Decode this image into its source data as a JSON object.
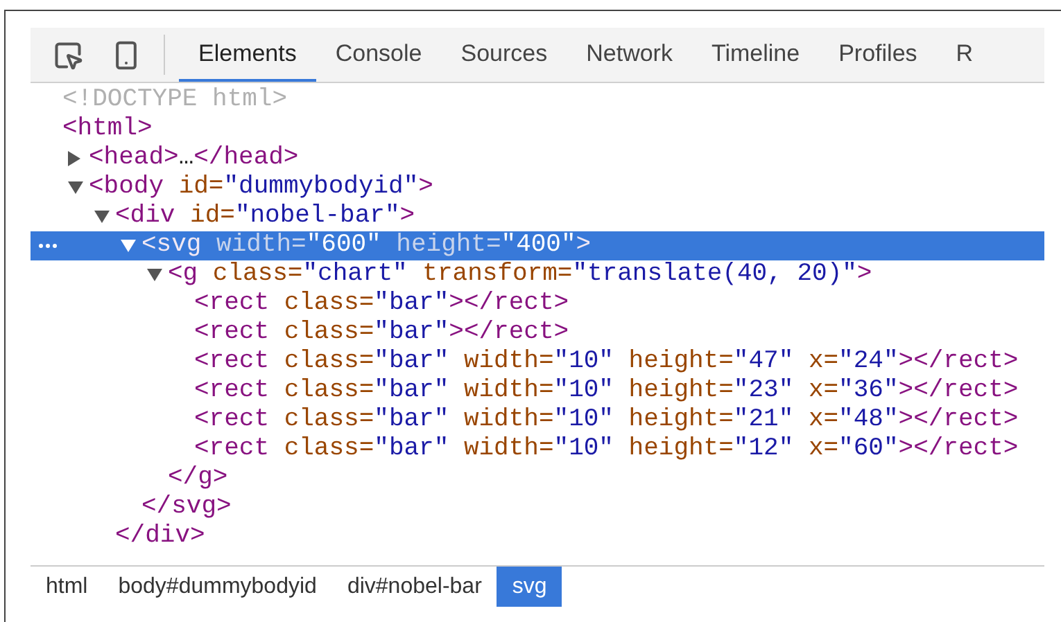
{
  "tabs": [
    {
      "label": "Elements",
      "selected": true
    },
    {
      "label": "Console",
      "selected": false
    },
    {
      "label": "Sources",
      "selected": false
    },
    {
      "label": "Network",
      "selected": false
    },
    {
      "label": "Timeline",
      "selected": false
    },
    {
      "label": "Profiles",
      "selected": false
    },
    {
      "label": "R",
      "selected": false
    }
  ],
  "tree": [
    {
      "selected": false,
      "tokens": [
        {
          "kind": "doctype",
          "text": "<!DOCTYPE html>"
        }
      ]
    },
    {
      "selected": false,
      "tokens": [
        {
          "kind": "tag",
          "text": "<html>"
        }
      ],
      "children": [
        {
          "selected": false,
          "expanded": false,
          "tokens": [
            {
              "kind": "tag",
              "text": "<head>"
            },
            {
              "kind": "text",
              "text": "…"
            },
            {
              "kind": "tag",
              "text": "</head>"
            }
          ]
        },
        {
          "selected": false,
          "expanded": true,
          "tokens": [
            {
              "kind": "tag",
              "text": "<body"
            },
            {
              "kind": "attr",
              "text": " id="
            },
            {
              "kind": "value",
              "text": "\"dummybodyid\""
            },
            {
              "kind": "tag",
              "text": ">"
            }
          ],
          "children": [
            {
              "selected": false,
              "expanded": true,
              "tokens": [
                {
                  "kind": "tag",
                  "text": "<div"
                },
                {
                  "kind": "attr",
                  "text": " id="
                },
                {
                  "kind": "value",
                  "text": "\"nobel-bar\""
                },
                {
                  "kind": "tag",
                  "text": ">"
                }
              ],
              "close": [
                {
                  "kind": "tag",
                  "text": "</div>"
                }
              ],
              "children": [
                {
                  "selected": true,
                  "expanded": true,
                  "tokens": [
                    {
                      "kind": "tag",
                      "text": "<svg"
                    },
                    {
                      "kind": "attr",
                      "text": " width="
                    },
                    {
                      "kind": "value",
                      "text": "\"600\""
                    },
                    {
                      "kind": "attr",
                      "text": " height="
                    },
                    {
                      "kind": "value",
                      "text": "\"400\""
                    },
                    {
                      "kind": "tag",
                      "text": ">"
                    }
                  ],
                  "close": [
                    {
                      "kind": "tag",
                      "text": "</svg>"
                    }
                  ],
                  "children": [
                    {
                      "selected": false,
                      "expanded": true,
                      "tokens": [
                        {
                          "kind": "tag",
                          "text": "<g"
                        },
                        {
                          "kind": "attr",
                          "text": " class="
                        },
                        {
                          "kind": "value",
                          "text": "\"chart\""
                        },
                        {
                          "kind": "attr",
                          "text": " transform="
                        },
                        {
                          "kind": "value",
                          "text": "\"translate(40, 20)\""
                        },
                        {
                          "kind": "tag",
                          "text": ">"
                        }
                      ],
                      "close": [
                        {
                          "kind": "tag",
                          "text": "</g>"
                        }
                      ],
                      "children": [
                        {
                          "selected": false,
                          "tokens": [
                            {
                              "kind": "tag",
                              "text": "<rect"
                            },
                            {
                              "kind": "attr",
                              "text": " class="
                            },
                            {
                              "kind": "value",
                              "text": "\"bar\""
                            },
                            {
                              "kind": "tag",
                              "text": "></rect>"
                            }
                          ]
                        },
                        {
                          "selected": false,
                          "tokens": [
                            {
                              "kind": "tag",
                              "text": "<rect"
                            },
                            {
                              "kind": "attr",
                              "text": " class="
                            },
                            {
                              "kind": "value",
                              "text": "\"bar\""
                            },
                            {
                              "kind": "tag",
                              "text": "></rect>"
                            }
                          ]
                        },
                        {
                          "selected": false,
                          "tokens": [
                            {
                              "kind": "tag",
                              "text": "<rect"
                            },
                            {
                              "kind": "attr",
                              "text": " class="
                            },
                            {
                              "kind": "value",
                              "text": "\"bar\""
                            },
                            {
                              "kind": "attr",
                              "text": " width="
                            },
                            {
                              "kind": "value",
                              "text": "\"10\""
                            },
                            {
                              "kind": "attr",
                              "text": " height="
                            },
                            {
                              "kind": "value",
                              "text": "\"47\""
                            },
                            {
                              "kind": "attr",
                              "text": " x="
                            },
                            {
                              "kind": "value",
                              "text": "\"24\""
                            },
                            {
                              "kind": "tag",
                              "text": "></rect>"
                            }
                          ]
                        },
                        {
                          "selected": false,
                          "tokens": [
                            {
                              "kind": "tag",
                              "text": "<rect"
                            },
                            {
                              "kind": "attr",
                              "text": " class="
                            },
                            {
                              "kind": "value",
                              "text": "\"bar\""
                            },
                            {
                              "kind": "attr",
                              "text": " width="
                            },
                            {
                              "kind": "value",
                              "text": "\"10\""
                            },
                            {
                              "kind": "attr",
                              "text": " height="
                            },
                            {
                              "kind": "value",
                              "text": "\"23\""
                            },
                            {
                              "kind": "attr",
                              "text": " x="
                            },
                            {
                              "kind": "value",
                              "text": "\"36\""
                            },
                            {
                              "kind": "tag",
                              "text": "></rect>"
                            }
                          ]
                        },
                        {
                          "selected": false,
                          "tokens": [
                            {
                              "kind": "tag",
                              "text": "<rect"
                            },
                            {
                              "kind": "attr",
                              "text": " class="
                            },
                            {
                              "kind": "value",
                              "text": "\"bar\""
                            },
                            {
                              "kind": "attr",
                              "text": " width="
                            },
                            {
                              "kind": "value",
                              "text": "\"10\""
                            },
                            {
                              "kind": "attr",
                              "text": " height="
                            },
                            {
                              "kind": "value",
                              "text": "\"21\""
                            },
                            {
                              "kind": "attr",
                              "text": " x="
                            },
                            {
                              "kind": "value",
                              "text": "\"48\""
                            },
                            {
                              "kind": "tag",
                              "text": "></rect>"
                            }
                          ]
                        },
                        {
                          "selected": false,
                          "tokens": [
                            {
                              "kind": "tag",
                              "text": "<rect"
                            },
                            {
                              "kind": "attr",
                              "text": " class="
                            },
                            {
                              "kind": "value",
                              "text": "\"bar\""
                            },
                            {
                              "kind": "attr",
                              "text": " width="
                            },
                            {
                              "kind": "value",
                              "text": "\"10\""
                            },
                            {
                              "kind": "attr",
                              "text": " height="
                            },
                            {
                              "kind": "value",
                              "text": "\"12\""
                            },
                            {
                              "kind": "attr",
                              "text": " x="
                            },
                            {
                              "kind": "value",
                              "text": "\"60\""
                            },
                            {
                              "kind": "tag",
                              "text": "></rect>"
                            }
                          ]
                        }
                      ]
                    }
                  ]
                }
              ]
            }
          ]
        }
      ]
    }
  ],
  "breadcrumbs": [
    {
      "label": "html",
      "selected": false
    },
    {
      "label": "body#dummybodyid",
      "selected": false
    },
    {
      "label": "div#nobel-bar",
      "selected": false
    },
    {
      "label": "svg",
      "selected": true
    }
  ]
}
